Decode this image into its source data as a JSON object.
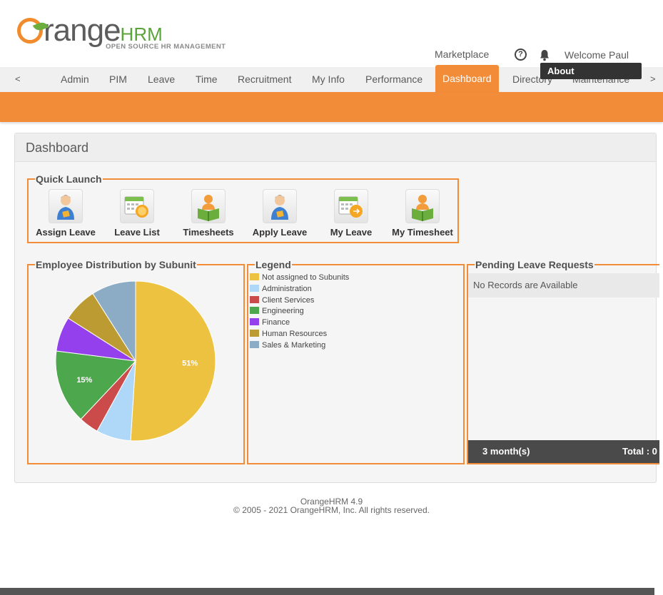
{
  "brand": {
    "logo_text": "Orange",
    "logo_accent": "HRM",
    "tagline": "OPEN SOURCE HR MANAGEMENT",
    "accent_color": "#f28c38"
  },
  "topbar": {
    "marketplace": "Marketplace",
    "help_icon": "question-circle-icon",
    "notification_icon": "bell-icon",
    "welcome": "Welcome Paul",
    "popup_item": "About"
  },
  "nav": {
    "prev_arrow": "<",
    "next_arrow": ">",
    "items": [
      {
        "label": "Admin"
      },
      {
        "label": "PIM"
      },
      {
        "label": "Leave"
      },
      {
        "label": "Time"
      },
      {
        "label": "Recruitment"
      },
      {
        "label": "My Info"
      },
      {
        "label": "Performance"
      },
      {
        "label": "Dashboard",
        "active": true
      },
      {
        "label": "Directory"
      },
      {
        "label": "Maintenance"
      }
    ]
  },
  "dashboard": {
    "title": "Dashboard",
    "quick_launch": {
      "title": "Quick Launch",
      "items": [
        {
          "label": "Assign Leave",
          "icon": "user-assign-icon"
        },
        {
          "label": "Leave List",
          "icon": "calendar-list-icon"
        },
        {
          "label": "Timesheets",
          "icon": "timesheet-book-icon"
        },
        {
          "label": "Apply Leave",
          "icon": "user-apply-icon"
        },
        {
          "label": "My Leave",
          "icon": "calendar-leave-icon"
        },
        {
          "label": "My Timesheet",
          "icon": "my-timesheet-book-icon"
        }
      ]
    },
    "distribution_title": "Employee Distribution by Subunit",
    "legend_title": "Legend",
    "pending": {
      "title": "Pending Leave Requests",
      "empty_text": "No Records are Available",
      "period": "3 month(s)",
      "total": "Total : 0"
    }
  },
  "chart_data": {
    "type": "pie",
    "categories": [
      "Not assigned to Subunits",
      "Administration",
      "Client Services",
      "Engineering",
      "Finance",
      "Human Resources",
      "Sales & Marketing"
    ],
    "values": [
      51,
      7,
      4,
      15,
      7,
      7,
      9
    ],
    "colors": [
      "#edc240",
      "#afd8f8",
      "#cb4b4b",
      "#4da74d",
      "#9440ed",
      "#bd9b33",
      "#8cacc6"
    ],
    "data_labels": [
      "51%",
      "",
      "",
      "15%",
      "",
      "",
      ""
    ],
    "legend_placement": "separate-panel"
  },
  "footer": {
    "version": "OrangeHRM 4.9",
    "copyright": "© 2005 - 2021 OrangeHRM, Inc. All rights reserved."
  }
}
